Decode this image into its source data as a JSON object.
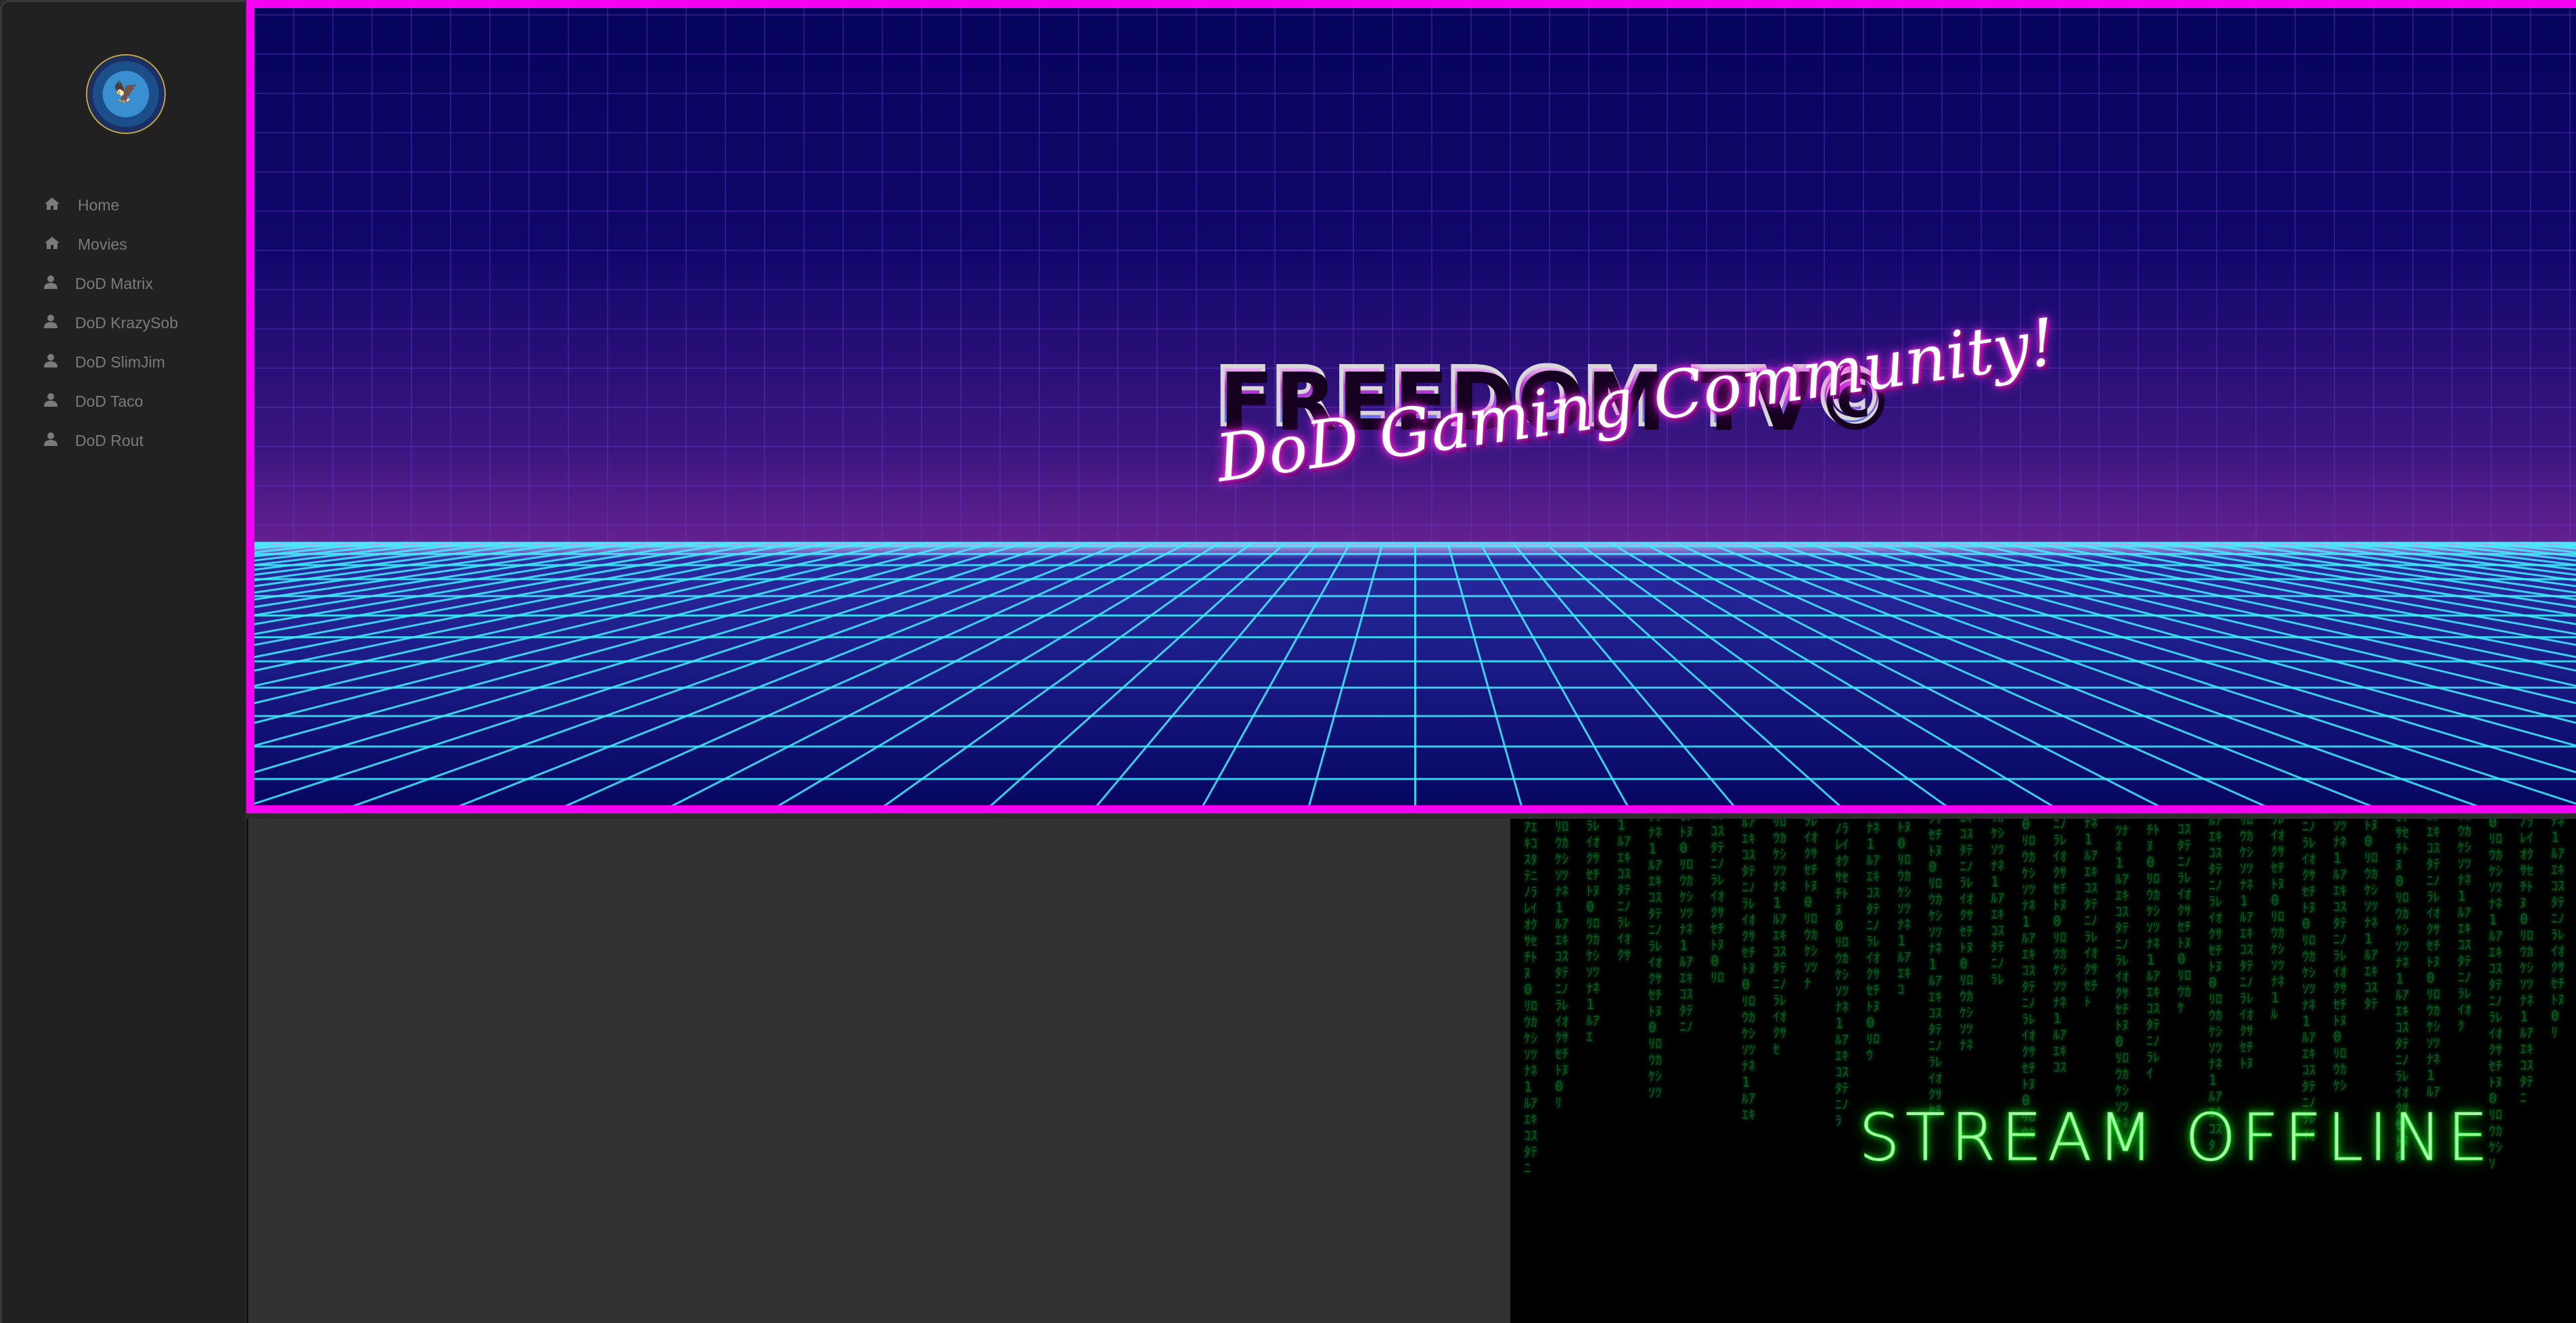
{
  "sidebar": {
    "logo_text": "Department of Defense - United States of America",
    "items": [
      {
        "label": "Home",
        "icon": "home-icon"
      },
      {
        "label": "Movies",
        "icon": "home-icon"
      },
      {
        "label": "DoD Matrix",
        "icon": "user-icon"
      },
      {
        "label": "DoD KrazySob",
        "icon": "user-icon"
      },
      {
        "label": "DoD SlimJim",
        "icon": "user-icon"
      },
      {
        "label": "DoD Taco",
        "icon": "user-icon"
      },
      {
        "label": "DoD Rout",
        "icon": "user-icon"
      }
    ]
  },
  "banner": {
    "title": "FREEDOM TV©",
    "subtitle": "DoD Gaming Community!",
    "border_color": "#f500f0"
  },
  "stream": {
    "status": "STREAM OFFLINE",
    "glow_color": "#20ff30"
  }
}
